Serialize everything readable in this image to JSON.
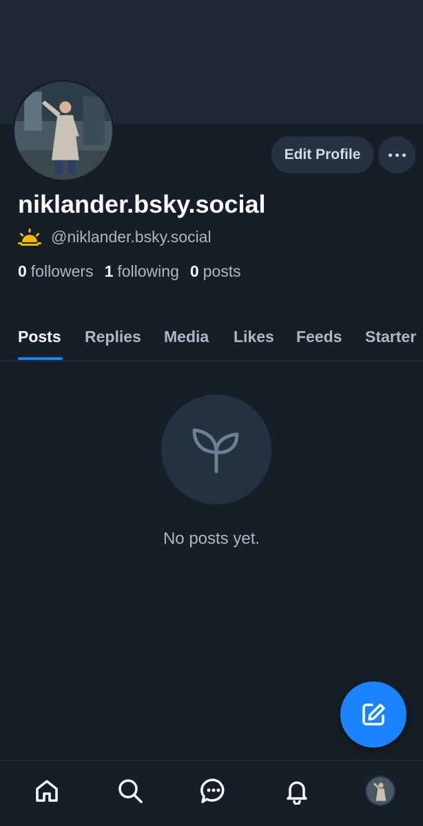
{
  "profile": {
    "display_name": "niklander.bsky.social",
    "handle": "@niklander.bsky.social",
    "badge_icon": "sunrise-emoji-icon",
    "avatar_alt": "profile photo of person in trench coat"
  },
  "actions": {
    "edit_profile_label": "Edit Profile",
    "more_icon": "ellipsis-icon"
  },
  "stats": {
    "followers_count": "0",
    "followers_label": "followers",
    "following_count": "1",
    "following_label": "following",
    "posts_count": "0",
    "posts_label": "posts"
  },
  "tabs": [
    {
      "label": "Posts",
      "active": true
    },
    {
      "label": "Replies",
      "active": false
    },
    {
      "label": "Media",
      "active": false
    },
    {
      "label": "Likes",
      "active": false
    },
    {
      "label": "Feeds",
      "active": false
    },
    {
      "label": "Starter",
      "active": false
    }
  ],
  "empty_state": {
    "icon": "sprout-icon",
    "message": "No posts yet."
  },
  "fab": {
    "icon": "compose-icon"
  },
  "bottom_nav": [
    {
      "icon": "home-icon"
    },
    {
      "icon": "search-icon"
    },
    {
      "icon": "chat-icon"
    },
    {
      "icon": "bell-icon"
    },
    {
      "icon": "profile-avatar"
    }
  ],
  "colors": {
    "background": "#161e27",
    "banner": "#1f2935",
    "accent": "#1a84ff",
    "muted_text": "#aeb8c3",
    "surface": "#263241"
  }
}
